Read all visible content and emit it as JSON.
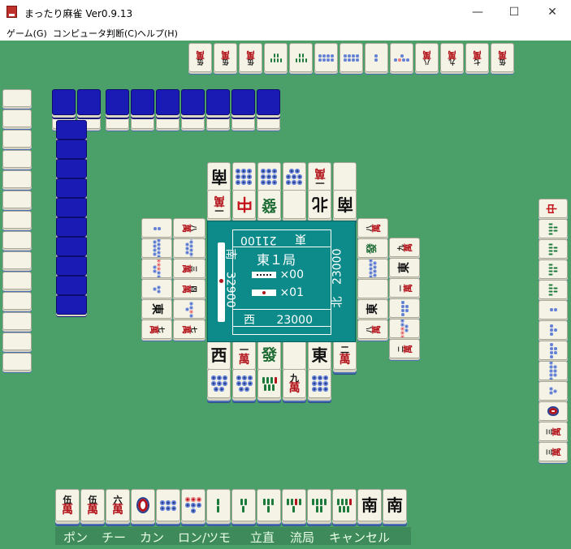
{
  "window": {
    "title": "まったり麻雀 Ver0.9.13",
    "minimize": "—",
    "maximize": "☐",
    "close": "✕"
  },
  "menu": [
    {
      "label": "ゲーム(G)"
    },
    {
      "label": "コンピュータ判断(C)"
    },
    {
      "label": "ヘルプ(H)"
    }
  ],
  "colors": {
    "table": "#4b9f69",
    "tile_face": "#f5f3e6",
    "tile_back": "#1a1ab4",
    "center_panel": "#0d8b8b",
    "man_red": "#b3141c",
    "sou_green": "#1d6b33"
  },
  "center_panel": {
    "round": "東１局",
    "honba": "×00",
    "riichi_sticks": "×01",
    "players": [
      {
        "seat": "東",
        "score": "21100"
      },
      {
        "seat": "南",
        "score": "32900"
      },
      {
        "seat": "西",
        "score": "23000"
      },
      {
        "seat": "北",
        "score": "23000"
      }
    ]
  },
  "actions": [
    {
      "label": "ポン"
    },
    {
      "label": "チー"
    },
    {
      "label": "カン"
    },
    {
      "label": "ロン/ツモ"
    },
    {
      "label": "立直"
    },
    {
      "label": "流局"
    },
    {
      "label": "キャンセル"
    }
  ],
  "player_hand": [
    {
      "num": "伍",
      "suit": "萬"
    },
    {
      "num": "伍",
      "suit": "萬"
    },
    {
      "num": "六",
      "suit": "萬"
    },
    {
      "name": "1-pin"
    },
    {
      "name": "6-pin"
    },
    {
      "name": "7-pin"
    },
    {
      "name": "2-sou"
    },
    {
      "name": "3-sou"
    },
    {
      "name": "4-sou"
    },
    {
      "name": "5-sou"
    },
    {
      "name": "6-sou"
    },
    {
      "name": "7-sou"
    },
    {
      "honor": "南"
    },
    {
      "honor": "南"
    }
  ],
  "player_discards_row1": [
    {
      "honor": "西"
    },
    {
      "num": "一",
      "suit": "萬"
    },
    {
      "honor": "發"
    },
    {
      "honor": "白"
    },
    {
      "honor": "東"
    },
    {
      "num": "二",
      "suit": "萬"
    }
  ],
  "player_discards_row2": [
    {
      "name": "8-pin"
    },
    {
      "name": "8-pin"
    },
    {
      "name": "7-sou"
    },
    {
      "num": "九",
      "suit": "萬"
    },
    {
      "name": "9-pin"
    }
  ],
  "top_hand": [
    {
      "num": "伍",
      "suit": "萬"
    },
    {
      "num": "伍",
      "suit": "萬"
    },
    {
      "num": "伍",
      "suit": "萬"
    },
    {
      "name": "6-sou"
    },
    {
      "name": "6-sou"
    },
    {
      "name": "8-pin"
    },
    {
      "name": "8-pin"
    },
    {
      "name": "2-pin"
    },
    {
      "name": "5-pin"
    },
    {
      "num": "八",
      "suit": "萬"
    },
    {
      "num": "九",
      "suit": "萬"
    },
    {
      "num": "七",
      "suit": "萬"
    },
    {
      "num": "伍",
      "suit": "萬"
    }
  ],
  "top_discards_row1": [
    {
      "honor": "南"
    },
    {
      "name": "9-pin"
    },
    {
      "name": "9-pin"
    },
    {
      "name": "8-pin"
    },
    {
      "num": "一",
      "suit": "萬"
    },
    {
      "honor": "白"
    }
  ],
  "top_discards_row2": [
    {
      "num": "一",
      "suit": "萬"
    },
    {
      "honor": "中"
    },
    {
      "honor": "發"
    },
    {
      "honor": "白"
    },
    {
      "honor": "北"
    },
    {
      "honor": "南"
    }
  ],
  "left_discards_col1": [
    {
      "num": "八",
      "suit": "萬"
    },
    {
      "name": "9-pin"
    },
    {
      "num": "三",
      "suit": "萬"
    },
    {
      "num": "四",
      "suit": "萬"
    },
    {
      "name": "5-pin"
    },
    {
      "num": "七",
      "suit": "萬"
    }
  ],
  "left_discards_col2": [
    {
      "name": "2-pin"
    },
    {
      "name": "9-pin"
    },
    {
      "name": "7-pin"
    },
    {
      "name": "3-pin"
    },
    {
      "honor": "東"
    },
    {
      "num": "七",
      "suit": "萬"
    }
  ],
  "right_discards_col1": [
    {
      "num": "八",
      "suit": "萬"
    },
    {
      "honor": "發"
    },
    {
      "name": "9-pin"
    },
    {
      "honor": "白"
    },
    {
      "honor": "東"
    },
    {
      "num": "八",
      "suit": "萬"
    }
  ],
  "right_discards_col2": [
    {
      "num": "九",
      "suit": "萬"
    },
    {
      "honor": "東"
    },
    {
      "num": "一",
      "suit": "萬"
    },
    {
      "name": "6-pin"
    },
    {
      "name": "7-pin"
    },
    {
      "num": "二",
      "suit": "萬"
    }
  ],
  "right_hand": [
    {
      "honor": "中"
    },
    {
      "name": "green-dragon-sou"
    },
    {
      "name": "green-dragon-sou"
    },
    {
      "name": "green-dragon-sou"
    },
    {
      "name": "green-dragon-sou"
    },
    {
      "name": "2-pin"
    },
    {
      "name": "4-pin"
    },
    {
      "name": "6-pin"
    },
    {
      "name": "8-pin"
    },
    {
      "name": "3-pin"
    },
    {
      "name": "1-pin"
    },
    {
      "num": "三",
      "suit": "萬"
    },
    {
      "num": "三",
      "suit": "萬"
    }
  ]
}
